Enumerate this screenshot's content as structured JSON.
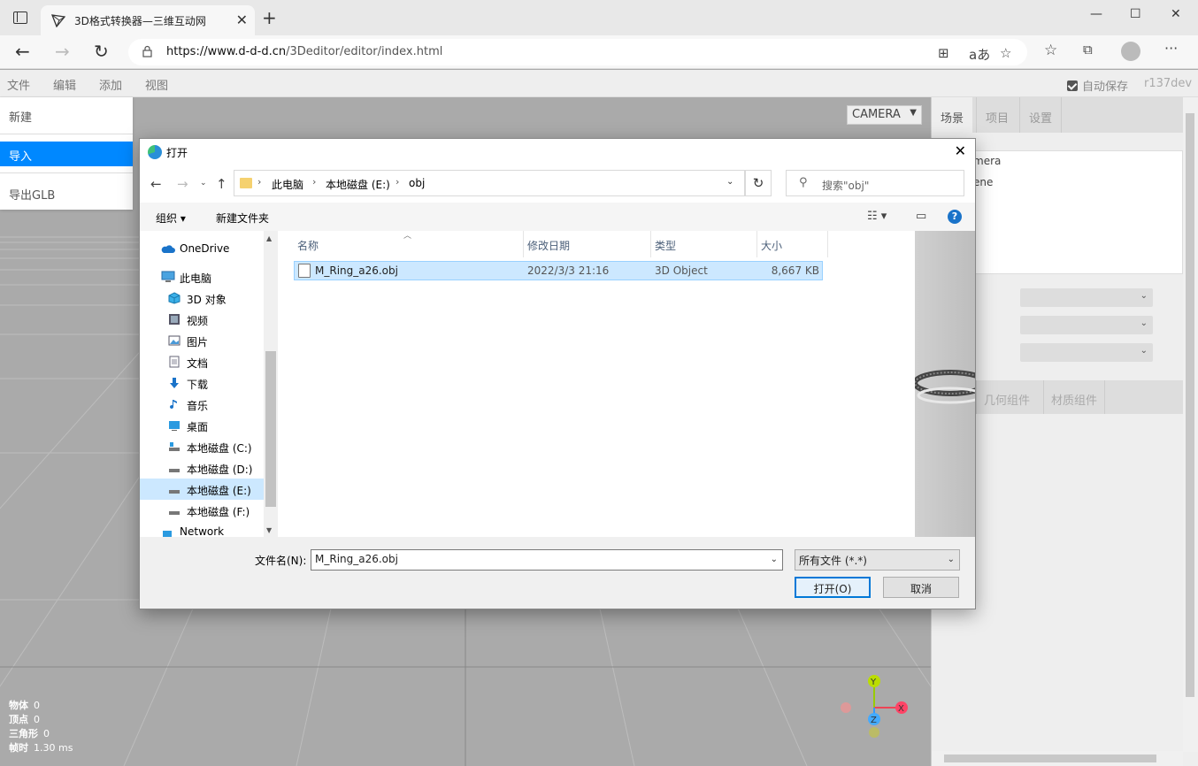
{
  "browser": {
    "tab_title": "3D格式转换器—三维互动网",
    "url_host": "https://www.d-d-d.cn",
    "url_path": "/3Deditor/editor/index.html"
  },
  "editor": {
    "menu": [
      "文件",
      "编辑",
      "添加",
      "视图"
    ],
    "autosave_label": "自动保存",
    "version": "r137dev",
    "file_menu": {
      "items": [
        "新建",
        "导入",
        "导出GLB"
      ],
      "active": "导入"
    },
    "camera_select": "CAMERA",
    "sidebar": {
      "tabs": [
        "场景",
        "项目",
        "设置"
      ],
      "outliner": [
        "mera",
        "ene"
      ],
      "property_tabs": [
        "几何组件",
        "材质组件"
      ]
    },
    "info": {
      "objects_label": "物体",
      "objects": "0",
      "vertices_label": "顶点",
      "vertices": "0",
      "triangles_label": "三角形",
      "triangles": "0",
      "frametime_label": "帧时",
      "frametime": "1.30 ms"
    },
    "gizmo": {
      "x": "X",
      "y": "Y",
      "z": "Z"
    }
  },
  "dialog": {
    "title": "打开",
    "breadcrumb": [
      "此电脑",
      "本地磁盘 (E:)",
      "obj"
    ],
    "search_placeholder": "搜索\"obj\"",
    "toolbar": {
      "organize": "组织",
      "new_folder": "新建文件夹"
    },
    "nav_items": [
      {
        "label": "OneDrive",
        "icon": "cloud-icon"
      },
      {
        "label": "此电脑",
        "icon": "computer-icon"
      },
      {
        "label": "3D 对象",
        "icon": "cube-icon"
      },
      {
        "label": "视频",
        "icon": "video-icon"
      },
      {
        "label": "图片",
        "icon": "picture-icon"
      },
      {
        "label": "文档",
        "icon": "document-icon"
      },
      {
        "label": "下载",
        "icon": "download-icon"
      },
      {
        "label": "音乐",
        "icon": "music-icon"
      },
      {
        "label": "桌面",
        "icon": "desktop-icon"
      },
      {
        "label": "本地磁盘 (C:)",
        "icon": "drive-icon"
      },
      {
        "label": "本地磁盘 (D:)",
        "icon": "drive-icon"
      },
      {
        "label": "本地磁盘 (E:)",
        "icon": "drive-icon"
      },
      {
        "label": "本地磁盘 (F:)",
        "icon": "drive-icon"
      },
      {
        "label": "Network",
        "icon": "network-icon"
      }
    ],
    "columns": [
      "名称",
      "修改日期",
      "类型",
      "大小"
    ],
    "files": [
      {
        "name": "M_Ring_a26.obj",
        "date": "2022/3/3 21:16",
        "type": "3D Object",
        "size": "8,667 KB"
      }
    ],
    "filename_label": "文件名(N):",
    "filename_value": "M_Ring_a26.obj",
    "filter": "所有文件 (*.*)",
    "open_button": "打开(O)",
    "cancel_button": "取消"
  }
}
